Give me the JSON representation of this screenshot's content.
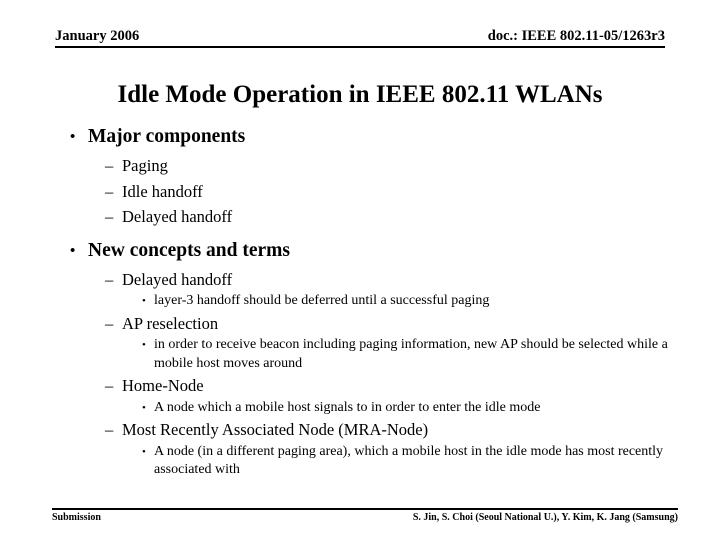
{
  "header": {
    "date": "January 2006",
    "doc": "doc.: IEEE 802.11-05/1263r3"
  },
  "title": "Idle Mode Operation in IEEE 802.11 WLANs",
  "bullets": {
    "major_components": "Major components",
    "paging": "Paging",
    "idle_handoff": "Idle handoff",
    "delayed_handoff": "Delayed handoff",
    "new_concepts": "New concepts and terms",
    "delayed_handoff_2": "Delayed handoff",
    "layer3": "layer-3 handoff should be deferred until a successful paging",
    "ap_reselection": "AP reselection",
    "ap_reselection_detail": "in order to receive beacon including paging information, new AP should be selected while a mobile host moves around",
    "home_node": "Home-Node",
    "home_node_detail": "A node which a mobile host signals to in order to enter the idle mode",
    "mra_node": "Most Recently Associated Node (MRA-Node)",
    "mra_node_detail": "A node (in a different paging area), which a mobile host in the idle mode has most recently associated with"
  },
  "marks": {
    "bullet": "•",
    "dash": "–"
  },
  "footer": {
    "left": "Submission",
    "right": "S. Jin, S. Choi (Seoul National U.), Y. Kim, K. Jang (Samsung)"
  },
  "colors": {
    "text": "#000000",
    "background": "#ffffff"
  }
}
